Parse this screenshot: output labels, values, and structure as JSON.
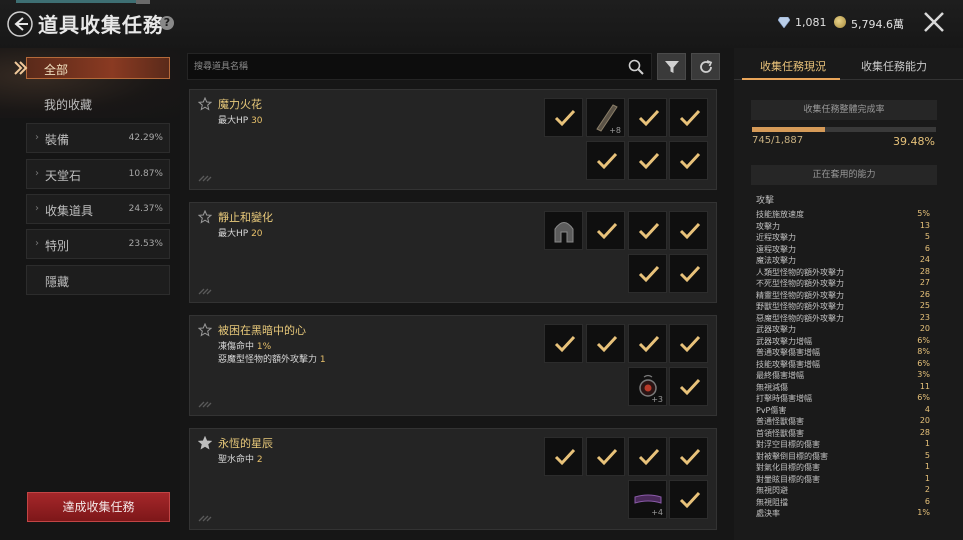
{
  "header": {
    "title": "道具收集任務",
    "help": "?",
    "diamonds": "1,081",
    "gold": "5,794.6萬"
  },
  "sidebar": {
    "all_label": "全部",
    "favorites_label": "我的收藏",
    "categories": [
      {
        "label": "裝備",
        "pct": "42.29%"
      },
      {
        "label": "天堂石",
        "pct": "10.87%"
      },
      {
        "label": "收集道具",
        "pct": "24.37%"
      },
      {
        "label": "特別",
        "pct": "23.53%"
      }
    ],
    "hidden_label": "隱藏",
    "complete_button": "達成收集任務"
  },
  "search": {
    "placeholder": "搜尋道具名稱"
  },
  "cards": [
    {
      "title": "魔力火花",
      "stats": [
        {
          "label": "最大HP",
          "value": "30"
        }
      ],
      "starred": false,
      "slot_plus": "+8"
    },
    {
      "title": "靜止和變化",
      "stats": [
        {
          "label": "最大HP",
          "value": "20"
        }
      ],
      "starred": false
    },
    {
      "title": "被困在黑暗中的心",
      "stats": [
        {
          "label": "凍傷命中",
          "value": "1%"
        },
        {
          "label": "惡魔型怪物的額外攻擊力",
          "value": "1"
        }
      ],
      "starred": false,
      "slot_plus": "+3"
    },
    {
      "title": "永恆的星辰",
      "stats": [
        {
          "label": "聖水命中",
          "value": "2"
        }
      ],
      "starred": true,
      "slot_plus": "+4"
    }
  ],
  "right_panel": {
    "tabs": [
      "收集任務現況",
      "收集任務能力"
    ],
    "overall_header": "收集任務整體完成率",
    "progress_count": "745/1,887",
    "progress_pct": "39.48%",
    "progress_fraction": 0.3948,
    "active_header": "正在套用的能力",
    "stat_category": "攻擊",
    "stats": [
      {
        "label": "技能施放速度",
        "value": "5%"
      },
      {
        "label": "攻擊力",
        "value": "13"
      },
      {
        "label": "近程攻擊力",
        "value": "5"
      },
      {
        "label": "遠程攻擊力",
        "value": "6"
      },
      {
        "label": "魔法攻擊力",
        "value": "24"
      },
      {
        "label": "人類型怪物的額外攻擊力",
        "value": "28"
      },
      {
        "label": "不死型怪物的額外攻擊力",
        "value": "27"
      },
      {
        "label": "精靈型怪物的額外攻擊力",
        "value": "26"
      },
      {
        "label": "野獸型怪物的額外攻擊力",
        "value": "25"
      },
      {
        "label": "惡魔型怪物的額外攻擊力",
        "value": "23"
      },
      {
        "label": "武器攻擊力",
        "value": "20"
      },
      {
        "label": "武器攻擊力增幅",
        "value": "6%"
      },
      {
        "label": "普通攻擊傷害增幅",
        "value": "8%"
      },
      {
        "label": "技能攻擊傷害增幅",
        "value": "6%"
      },
      {
        "label": "最終傷害增幅",
        "value": "3%"
      },
      {
        "label": "無視減傷",
        "value": "11"
      },
      {
        "label": "打擊時傷害增幅",
        "value": "6%"
      },
      {
        "label": "PvP傷害",
        "value": "4"
      },
      {
        "label": "普通怪獸傷害",
        "value": "20"
      },
      {
        "label": "首領怪獸傷害",
        "value": "28"
      },
      {
        "label": "對浮空目標的傷害",
        "value": "1"
      },
      {
        "label": "對被擊倒目標的傷害",
        "value": "5"
      },
      {
        "label": "對氣化目標的傷害",
        "value": "1"
      },
      {
        "label": "對暈眩目標的傷害",
        "value": "1"
      },
      {
        "label": "無視閃避",
        "value": "2"
      },
      {
        "label": "無視阻擋",
        "value": "6"
      },
      {
        "label": "處決率",
        "value": "1%"
      }
    ]
  },
  "colors": {
    "accent_gold": "#e9c27a",
    "complete_red": "#a5272a",
    "check_gold": "#e8c27a"
  }
}
